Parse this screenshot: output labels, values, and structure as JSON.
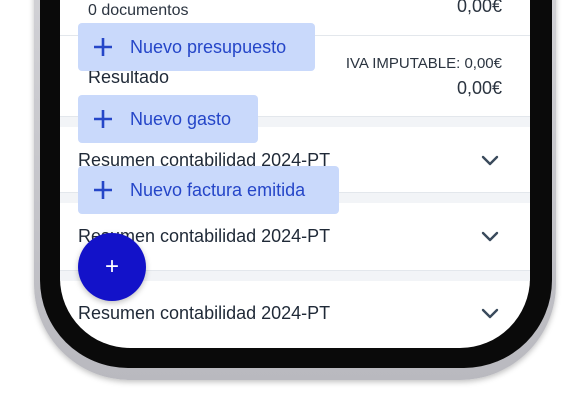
{
  "summary_top": {
    "documents_count": "0 documentos",
    "documents_amount": "0,00€",
    "iva_label": "IVA IMPUTABLE: 0,00€",
    "result_label": "Resultado",
    "result_amount": "0,00€"
  },
  "accordion": [
    {
      "label": "Resumen contabilidad 2024-PT",
      "icon": "chevron-down-icon"
    },
    {
      "label": "Resumen contabilidad 2024-PT",
      "icon": "chevron-down-icon"
    },
    {
      "label": "Resumen contabilidad 2024-PT",
      "icon": "chevron-down-icon"
    }
  ],
  "speed_dial": {
    "items": [
      {
        "label": "Nuevo presupuesto",
        "icon": "plus-icon"
      },
      {
        "label": "Nuevo gasto",
        "icon": "plus-icon"
      },
      {
        "label": "Nuevo factura emitida",
        "icon": "plus-icon"
      }
    ],
    "fab_label": "+"
  },
  "colors": {
    "fab": "#1312c9",
    "speed_item_bg": "#c9d9fb",
    "speed_item_text": "#2546c8",
    "chevron": "#3a4a5c"
  }
}
